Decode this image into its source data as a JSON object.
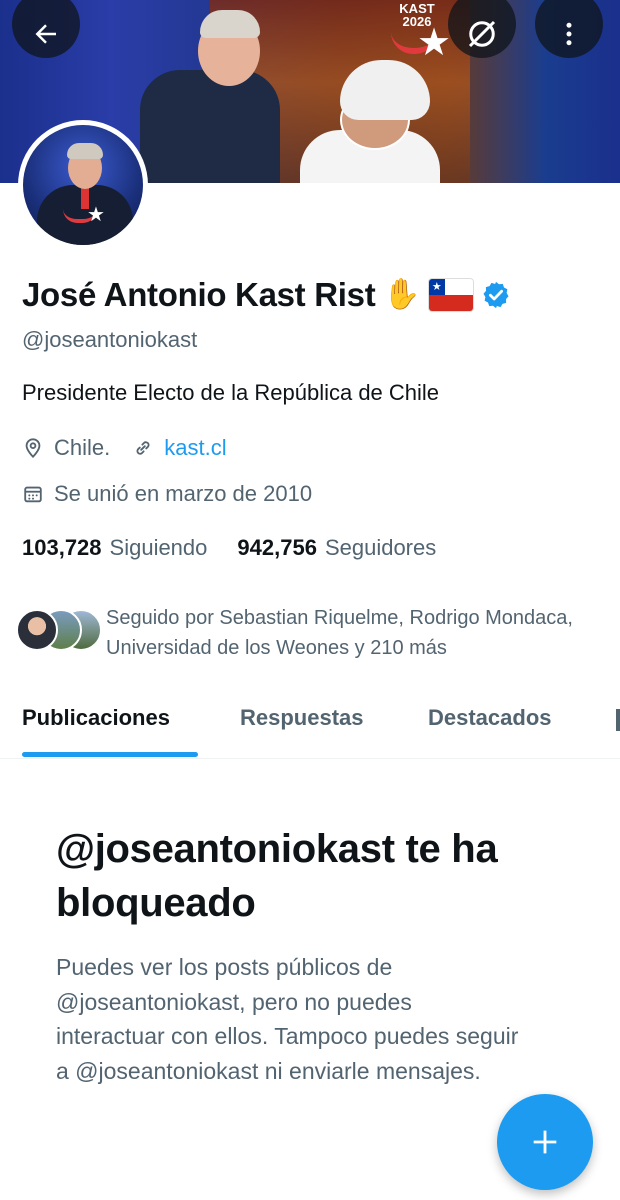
{
  "header": {
    "back_icon": "arrow-left-icon",
    "grok_icon": "grok-icon",
    "more_icon": "more-vertical-icon",
    "banner_logo": {
      "line1": "KAST",
      "line2": "2026"
    }
  },
  "profile": {
    "name": "José Antonio Kast Rist",
    "name_emoji": "✋",
    "handle": "@joseantoniokast",
    "bio": "Presidente Electo de la República de Chile",
    "location": "Chile.",
    "website": "kast.cl",
    "joined": "Se unió en marzo de 2010",
    "following_count": "103,728",
    "following_label": "Siguiendo",
    "followers_count": "942,756",
    "followers_label": "Seguidores",
    "followed_by": "Seguido por Sebastian Riquelme, Rodrigo Mondaca, Universidad de los Weones y 210 más"
  },
  "tabs": [
    {
      "label": "Publicaciones",
      "active": true
    },
    {
      "label": "Respuestas",
      "active": false
    },
    {
      "label": "Destacados",
      "active": false
    }
  ],
  "blocked": {
    "title": "@joseantoniokast te ha bloqueado",
    "description": "Puedes ver los posts públicos de @joseantoniokast, pero no puedes interactuar con ellos. Tampoco puedes seguir a @joseantoniokast ni enviarle mensajes."
  },
  "fab": {
    "icon": "plus-icon"
  },
  "colors": {
    "accent": "#1d9bf0",
    "text_primary": "#0f1419",
    "text_secondary": "#536471"
  }
}
